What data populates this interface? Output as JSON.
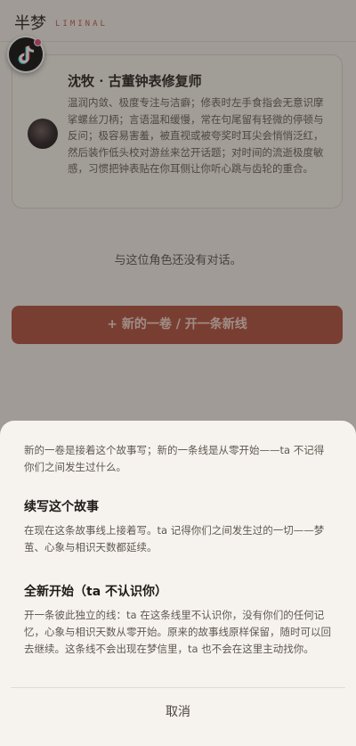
{
  "header": {
    "brand": "半梦",
    "brand_sub": "LIMINAL"
  },
  "fab": {
    "icon": "tiktok-icon"
  },
  "character": {
    "name": "沈牧 · 古董钟表修复师",
    "description": "温润内敛、极度专注与洁癖；修表时左手食指会无意识摩挲螺丝刀柄；言语温和缓慢，常在句尾留有轻微的停顿与反问；极容易害羞，被直视或被夸奖时耳尖会悄悄泛红，然后装作低头校对游丝来岔开话题；对时间的流逝极度敏感，习惯把钟表贴在你耳侧让你听心跳与齿轮的重合。"
  },
  "empty_state": "与这位角色还没有对话。",
  "primary_action": "+ 新的一卷 / 开一条新线",
  "sheet": {
    "intro": "新的一卷是接着这个故事写；新的一条线是从零开始——ta 不记得你们之间发生过什么。",
    "options": [
      {
        "title": "续写这个故事",
        "description": "在现在这条故事线上接着写。ta 记得你们之间发生过的一切——梦茧、心象与相识天数都延续。"
      },
      {
        "title": "全新开始（ta 不认识你）",
        "description": "开一条彼此独立的线：ta 在这条线里不认识你，没有你们的任何记忆，心象与相识天数从零开始。原来的故事线原样保留，随时可以回去继续。这条线不会出现在梦信里，ta 也不会在这里主动找你。"
      }
    ],
    "cancel": "取消"
  },
  "colors": {
    "accent": "#b3523f",
    "overlay": "rgba(40,36,33,0.42)",
    "background": "#f6f2ea"
  }
}
